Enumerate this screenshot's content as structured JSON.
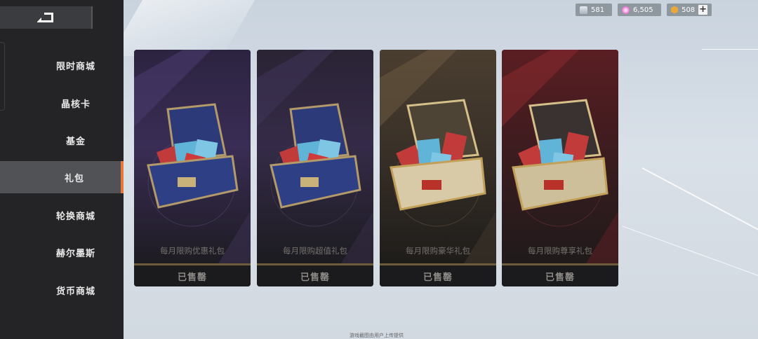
{
  "sidebar": {
    "items": [
      {
        "label": "限时商城",
        "active": false
      },
      {
        "label": "晶核卡",
        "active": false
      },
      {
        "label": "基金",
        "active": false
      },
      {
        "label": "礼包",
        "active": true
      },
      {
        "label": "轮换商城",
        "active": false
      },
      {
        "label": "赫尔墨斯",
        "active": false
      },
      {
        "label": "货币商城",
        "active": false
      }
    ]
  },
  "currency": [
    {
      "value": "581",
      "icon": "crystal-stack-icon",
      "color": "#b9c3cf"
    },
    {
      "value": "6,505",
      "icon": "pink-orb-icon",
      "color": "#e36fd0"
    },
    {
      "value": "508",
      "icon": "gold-hexagon-icon",
      "color": "#e9a93a"
    }
  ],
  "packs": [
    {
      "name": "每月限购优惠礼包",
      "status": "已售罄",
      "theme": "purple"
    },
    {
      "name": "每月限购超值礼包",
      "status": "已售罄",
      "theme": "purple"
    },
    {
      "name": "每月限购豪华礼包",
      "status": "已售罄",
      "theme": "gold"
    },
    {
      "name": "每月限购尊享礼包",
      "status": "已售罄",
      "theme": "red"
    }
  ],
  "footer": {
    "notice": "游戏截图由用户上传提供"
  },
  "colors": {
    "accent": "#e8783a",
    "sidebar": "#242426",
    "active": "#505256"
  }
}
